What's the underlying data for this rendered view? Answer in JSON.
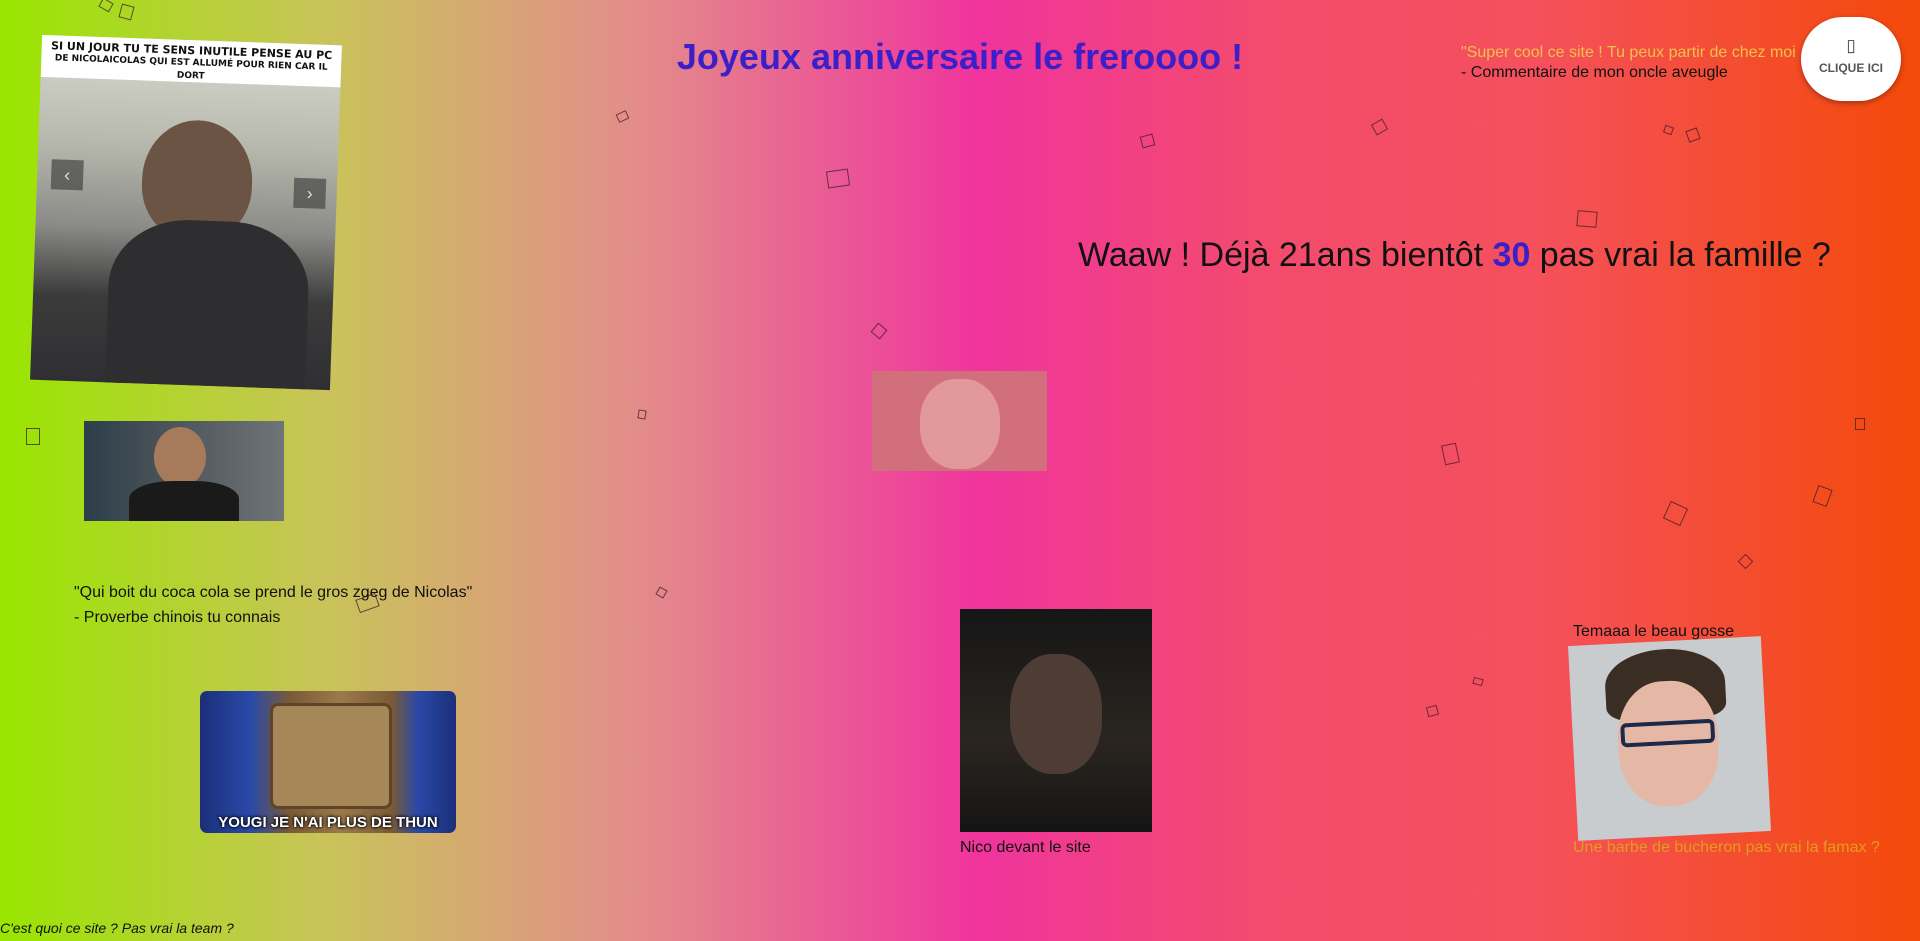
{
  "title": "Joyeux anniversaire le freroooo !",
  "comment": {
    "quote": "\"Super cool ce site ! Tu peux partir de chez moi m",
    "author": "- Commentaire de mon oncle aveugle"
  },
  "click_button": {
    "icon": "square-icon",
    "glyph": "▯",
    "label": "CLIQUE ICI"
  },
  "age_text": {
    "prefix": "Waaw ! Déjà 21ans bientôt ",
    "highlight": "30",
    "suffix": " pas vrai la famille ?"
  },
  "carousel": {
    "caption_line1": "SI UN JOUR TU TE SENS INUTILE PENSE AU PC",
    "caption_line2": "DE NICOLAICOLAS QUI EST ALLUMÉ POUR RIEN CAR IL DORT",
    "prev": "‹",
    "next": "›"
  },
  "proverb": {
    "quote": "\"Qui boit du coca cola se prend le gros zgeg de Nicolas\"",
    "author": "- Proverbe chinois tu connais"
  },
  "gif_caption": "YOUGI JE N'AI PLUS DE THUN",
  "nico_caption": "Nico devant le site",
  "temaaa_caption": "Temaaa le beau gosse",
  "barbe_caption": "Une barbe de bucheron pas vrai la famax ?",
  "footer": "C'est quoi ce site ? Pas vrai la team ?",
  "colors": {
    "title": "#3b1fc9",
    "highlight": "#3b1fc9",
    "comment_quote": "#f3c04d",
    "barbe_caption": "#e39c1e"
  }
}
